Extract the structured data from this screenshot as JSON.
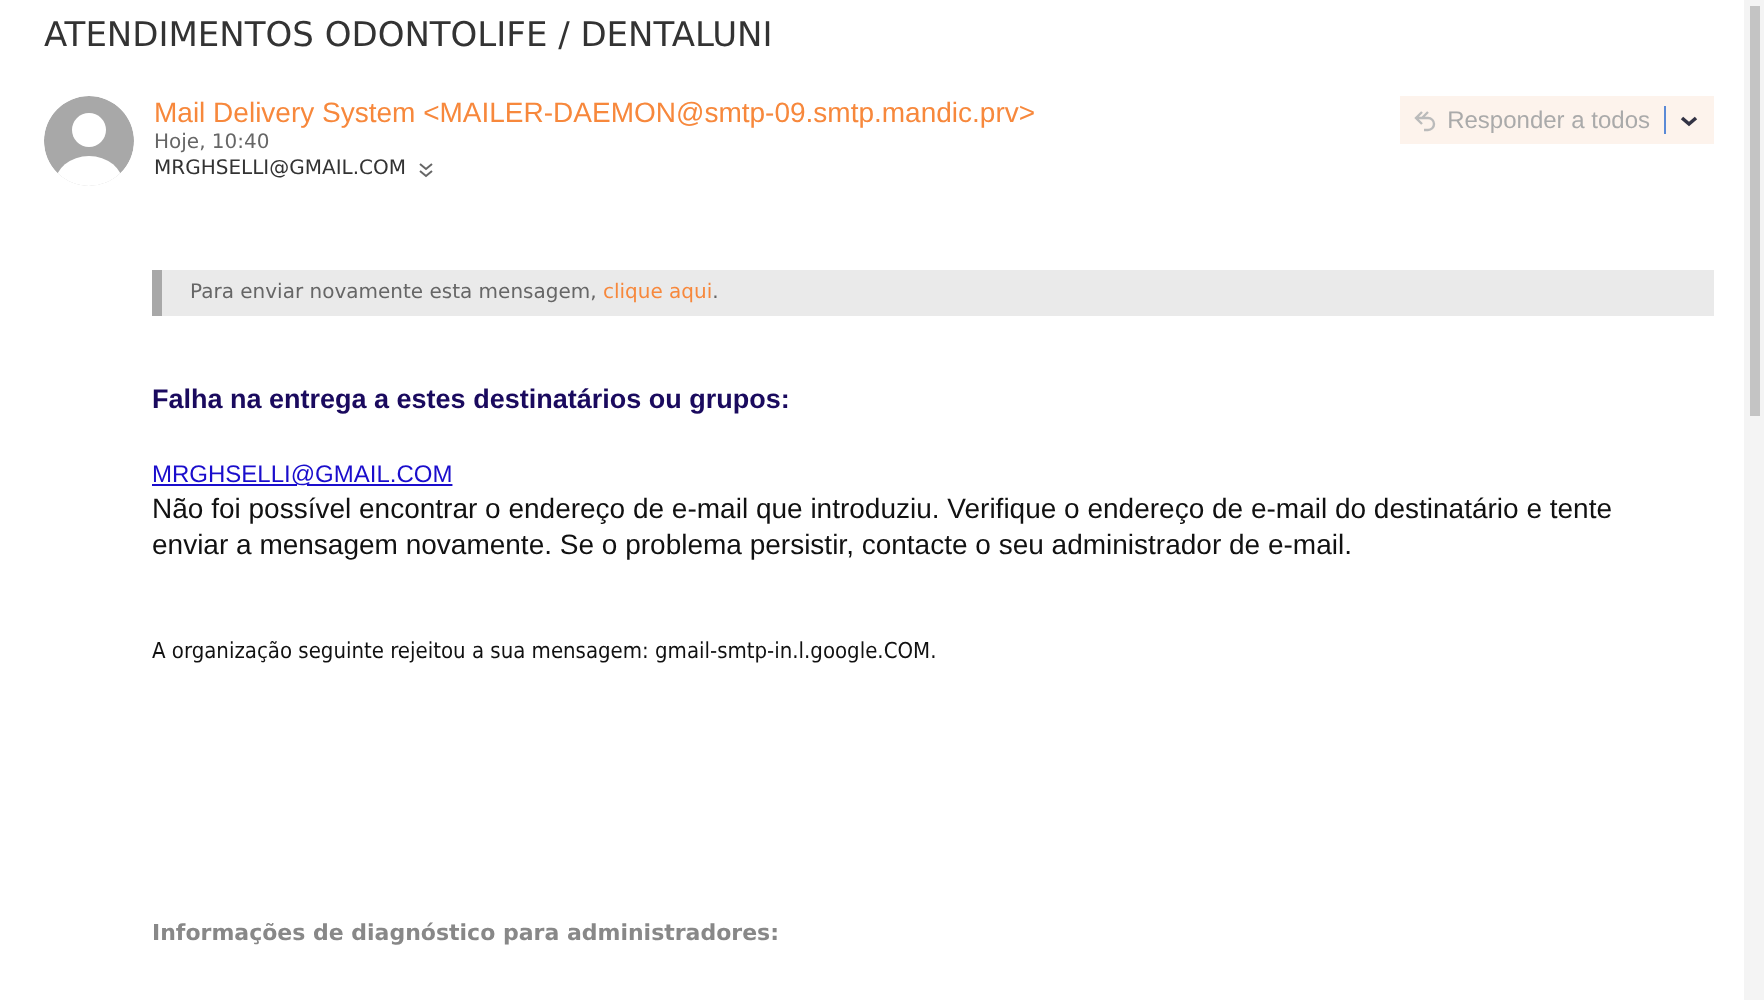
{
  "subject": "ATENDIMENTOS ODONTOLIFE / DENTALUNI",
  "sender": {
    "name": "Mail Delivery System <MAILER-DAEMON@smtp-09.smtp.mandic.prv>",
    "time": "Hoje, 10:40",
    "recipient": "MRGHSELLI@GMAIL.COM"
  },
  "reply_button": {
    "label": "Responder a todos",
    "disabled": true
  },
  "notice": {
    "text": "Para enviar novamente esta mensagem, ",
    "link": "clique aqui",
    "end": "."
  },
  "body": {
    "heading": "Falha na entrega a estes destinatários ou grupos:",
    "address": "MRGHSELLI@GMAIL.COM",
    "message": "Não foi possível encontrar o endereço de e-mail que introduziu. Verifique o endereço de e-mail do destinatário e tente enviar a mensagem novamente. Se o problema persistir, contacte o seu administrador de e-mail.",
    "rejection": "A organização seguinte rejeitou a sua mensagem: gmail-smtp-in.l.google.COM.",
    "diagnostics": "Informações de diagnóstico para administradores:"
  }
}
